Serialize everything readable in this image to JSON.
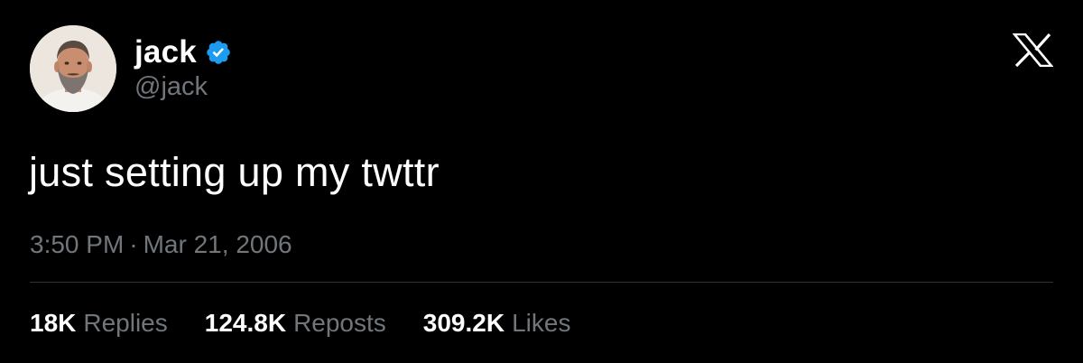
{
  "author": {
    "display_name": "jack",
    "handle": "@jack",
    "verified": true,
    "verified_icon": "verified-badge-icon",
    "avatar": "avatar-photo"
  },
  "platform_logo": "x-logo-icon",
  "tweet": {
    "text": "just setting up my twttr",
    "time": "3:50 PM",
    "separator": "·",
    "date": "Mar 21, 2006"
  },
  "stats": {
    "replies_count": "18K",
    "replies_label": "Replies",
    "reposts_count": "124.8K",
    "reposts_label": "Reposts",
    "likes_count": "309.2K",
    "likes_label": "Likes"
  },
  "colors": {
    "background": "#000000",
    "primary_text": "#ffffff",
    "secondary_text": "#71767b",
    "verified_blue": "#1d9bf0",
    "divider": "#2f3336"
  }
}
